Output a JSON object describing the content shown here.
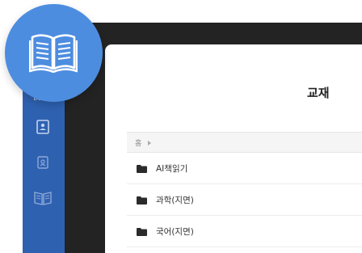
{
  "page": {
    "title": "교재"
  },
  "sidebar": {
    "label": "BOOKS",
    "items": [
      {
        "icon": "student-card-icon"
      },
      {
        "icon": "contact-card-icon"
      },
      {
        "icon": "open-book-icon"
      }
    ]
  },
  "badge": {
    "icon": "open-book-icon"
  },
  "breadcrumb": {
    "home": "홈"
  },
  "folders": [
    {
      "label": "AI책읽기"
    },
    {
      "label": "과학(지면)"
    },
    {
      "label": "국어(지면)"
    }
  ],
  "colors": {
    "rail": "#2e61b0",
    "badge": "#4d8de0",
    "bezel": "#232323"
  }
}
